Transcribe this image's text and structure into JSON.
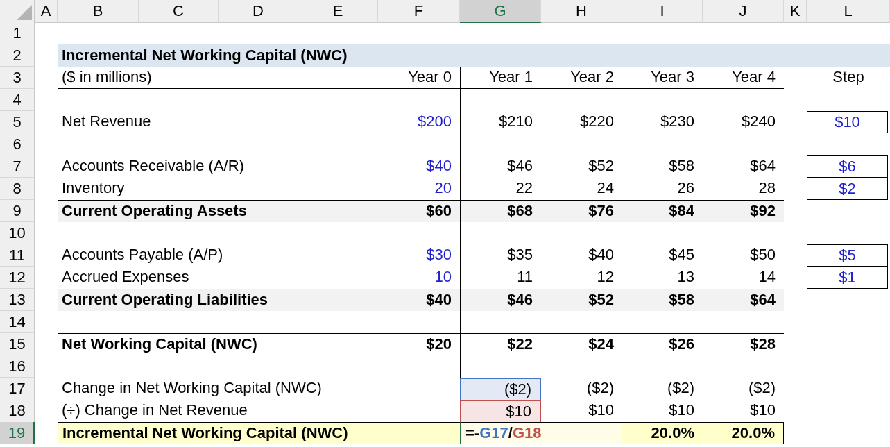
{
  "column_headers": [
    {
      "label": "A",
      "selected": false
    },
    {
      "label": "B",
      "selected": false
    },
    {
      "label": "C",
      "selected": false
    },
    {
      "label": "D",
      "selected": false
    },
    {
      "label": "E",
      "selected": false
    },
    {
      "label": "F",
      "selected": false
    },
    {
      "label": "G",
      "selected": true
    },
    {
      "label": "H",
      "selected": false
    },
    {
      "label": "I",
      "selected": false
    },
    {
      "label": "J",
      "selected": false
    },
    {
      "label": "K",
      "selected": false
    },
    {
      "label": "L",
      "selected": false
    }
  ],
  "rows": [
    {
      "number": "1",
      "selected": false,
      "kind": "blank"
    },
    {
      "number": "2",
      "selected": false,
      "kind": "title",
      "label": "Incremental Net Working Capital (NWC)"
    },
    {
      "number": "3",
      "selected": false,
      "kind": "header",
      "label": "($ in millions)",
      "cells": {
        "F": "Year 0",
        "G": "Year 1",
        "H": "Year 2",
        "I": "Year 3",
        "J": "Year 4"
      },
      "step": "Step"
    },
    {
      "number": "4",
      "selected": false,
      "kind": "blank"
    },
    {
      "number": "5",
      "selected": false,
      "kind": "line_item",
      "label": "Net Revenue",
      "cells": {
        "F": "$200",
        "G": "$210",
        "H": "$220",
        "I": "$230",
        "J": "$240"
      },
      "step": "$10"
    },
    {
      "number": "6",
      "selected": false,
      "kind": "blank"
    },
    {
      "number": "7",
      "selected": false,
      "kind": "line_item",
      "label": "Accounts Receivable (A/R)",
      "cells": {
        "F": "$40",
        "G": "$46",
        "H": "$52",
        "I": "$58",
        "J": "$64"
      },
      "step": "$6"
    },
    {
      "number": "8",
      "selected": false,
      "kind": "line_item",
      "label": "Inventory",
      "cells": {
        "F": "20",
        "G": "22",
        "H": "24",
        "I": "26",
        "J": "28"
      },
      "step": "$2"
    },
    {
      "number": "9",
      "selected": false,
      "kind": "total",
      "label": "Current Operating Assets",
      "cells": {
        "F": "$60",
        "G": "$68",
        "H": "$76",
        "I": "$84",
        "J": "$92"
      }
    },
    {
      "number": "10",
      "selected": false,
      "kind": "blank"
    },
    {
      "number": "11",
      "selected": false,
      "kind": "line_item",
      "label": "Accounts Payable (A/P)",
      "cells": {
        "F": "$30",
        "G": "$35",
        "H": "$40",
        "I": "$45",
        "J": "$50"
      },
      "step": "$5"
    },
    {
      "number": "12",
      "selected": false,
      "kind": "line_item",
      "label": "Accrued Expenses",
      "cells": {
        "F": "10",
        "G": "11",
        "H": "12",
        "I": "13",
        "J": "14"
      },
      "step": "$1"
    },
    {
      "number": "13",
      "selected": false,
      "kind": "total",
      "label": "Current Operating Liabilities",
      "cells": {
        "F": "$40",
        "G": "$46",
        "H": "$52",
        "I": "$58",
        "J": "$64"
      }
    },
    {
      "number": "14",
      "selected": false,
      "kind": "blank"
    },
    {
      "number": "15",
      "selected": false,
      "kind": "nwc",
      "label": "Net Working Capital (NWC)",
      "cells": {
        "F": "$20",
        "G": "$22",
        "H": "$24",
        "I": "$26",
        "J": "$28"
      }
    },
    {
      "number": "16",
      "selected": false,
      "kind": "blank"
    },
    {
      "number": "17",
      "selected": false,
      "kind": "calc",
      "label": "Change in Net Working Capital (NWC)",
      "cells": {
        "G": "($2)",
        "H": "($2)",
        "I": "($2)",
        "J": "($2)"
      },
      "color": "#4472c4"
    },
    {
      "number": "18",
      "selected": false,
      "kind": "calc",
      "label": "(÷) Change in Net Revenue",
      "cells": {
        "G": "$10",
        "H": "$10",
        "I": "$10",
        "J": "$10"
      },
      "color": "#c0504d"
    },
    {
      "number": "19",
      "selected": true,
      "kind": "result",
      "label": "Incremental Net Working Capital (NWC)",
      "cells": {
        "I": "20.0%",
        "J": "20.0%"
      },
      "formula": [
        {
          "text": "=-"
        },
        {
          "text": "G17",
          "color": "#4472c4"
        },
        {
          "text": "/"
        },
        {
          "text": "G18",
          "color": "#c0504d"
        }
      ]
    }
  ]
}
